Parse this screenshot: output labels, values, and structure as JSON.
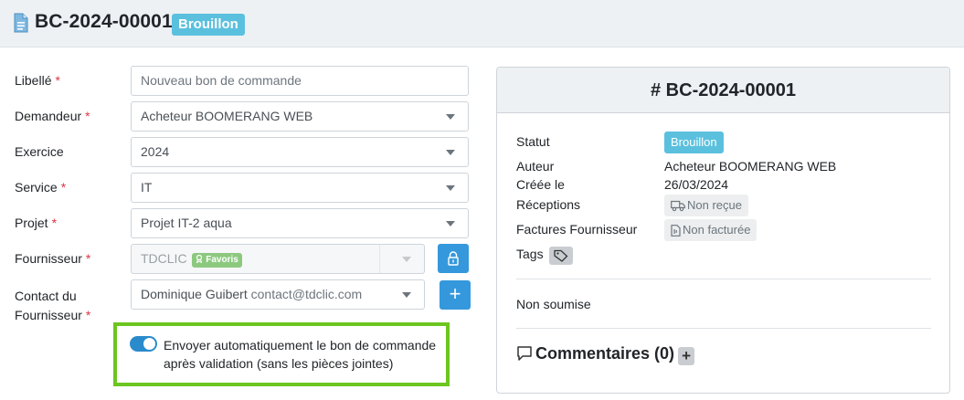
{
  "header": {
    "title": "BC-2024-00001",
    "status_badge": "Brouillon"
  },
  "form": {
    "libelle": {
      "label": "Libellé",
      "required": "*",
      "placeholder": "Nouveau bon de commande"
    },
    "demandeur": {
      "label": "Demandeur",
      "required": "*",
      "value": "Acheteur BOOMERANG WEB"
    },
    "exercice": {
      "label": "Exercice",
      "value": "2024"
    },
    "service": {
      "label": "Service",
      "required": "*",
      "value": "IT"
    },
    "projet": {
      "label": "Projet",
      "required": "*",
      "value": "Projet IT-2 aqua"
    },
    "fournisseur": {
      "label": "Fournisseur",
      "required": "*",
      "value": "TDCLIC",
      "badge": "Favoris"
    },
    "contact": {
      "label_line1": "Contact du",
      "label_line2": "Fournisseur",
      "required": "*",
      "name": "Dominique Guibert",
      "email": "contact@tdclic.com",
      "add_label": "+"
    },
    "auto_send": {
      "label": "Envoyer automatiquement le bon de commande après validation (sans les pièces jointes)",
      "checked": true
    }
  },
  "card": {
    "title": "# BC-2024-00001",
    "rows": {
      "statut": {
        "label": "Statut",
        "value": "Brouillon"
      },
      "auteur": {
        "label": "Auteur",
        "value": "Acheteur BOOMERANG WEB"
      },
      "creee": {
        "label": "Créée le",
        "value": "26/03/2024"
      },
      "receptions": {
        "label": "Réceptions",
        "value": "Non reçue"
      },
      "factures": {
        "label": "Factures Fournisseur",
        "value": "Non facturée"
      },
      "tags": {
        "label": "Tags"
      }
    },
    "submission": "Non soumise",
    "comments": {
      "label": "Commentaires (0)",
      "add": "+"
    }
  },
  "colors": {
    "accent_blue": "#3598dc",
    "info_badge": "#5bc0de",
    "highlight_green": "#6cc61f",
    "required_red": "#dc3545"
  }
}
